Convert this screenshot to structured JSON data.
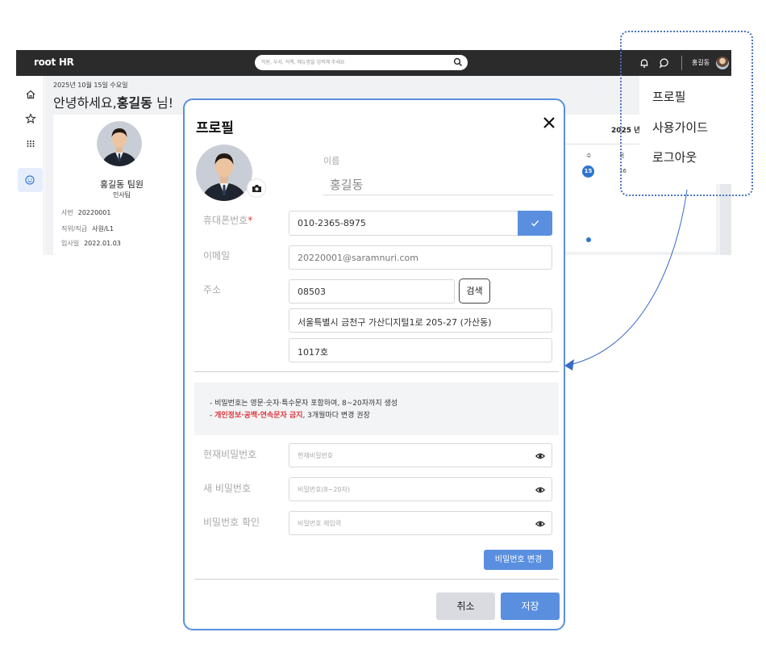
{
  "topbar": {
    "logo": "root HR",
    "search_placeholder": "직원, 부서, 직책, 메뉴명을 입력해 주세요",
    "user_name": "홍길동"
  },
  "dashboard": {
    "date": "2025년 10월 15일 수요일",
    "greeting_prefix": "안녕하세요,",
    "greeting_name": "홍길동",
    "greeting_suffix": " 님!",
    "profile_card": {
      "name": "홍길동  팀원",
      "dept": "인사팀",
      "info": [
        {
          "key": "사번",
          "value": "20220001"
        },
        {
          "key": "직위/직급",
          "value": "사원/L1"
        },
        {
          "key": "입사일",
          "value": "2022.01.03"
        }
      ]
    },
    "calendar": {
      "title": "2025 년",
      "weekday_1": "수",
      "weekday_2": "목",
      "today": "15",
      "next": "16"
    }
  },
  "user_menu": {
    "items": [
      "프로필",
      "사용가이드",
      "로그아웃"
    ]
  },
  "profile_modal": {
    "title": "프로필",
    "name_label": "이름",
    "name_value": "홍길동",
    "phone_label": "휴대폰번호",
    "phone_required": "*",
    "phone_value": "010-2365-8975",
    "email_label": "이메일",
    "email_value": "20220001@saramnuri.com",
    "address_label": "주소",
    "zipcode": "08503",
    "search_button": "검색",
    "address_line1": "서울특별시 금천구 가산디지털1로 205-27 (가산동)",
    "address_line2": "1017호",
    "notice": {
      "line1": "- 비밀번호는 영문·숫자·특수문자 포함하여, 8~20자까지 생성",
      "line2_prefix": "- ",
      "line2_red": "개인정보·공백·연속문자 금지",
      "line2_suffix": ", 3개월마다 변경 권장"
    },
    "current_pw_label": "현재비밀번호",
    "current_pw_placeholder": "현재비밀번호",
    "new_pw_label": "새 비밀번호",
    "new_pw_placeholder": "비밀번호(8~20자)",
    "confirm_pw_label": "비밀번호 확인",
    "confirm_pw_placeholder": "비밀번호 재입력",
    "change_pw_button": "비밀번호 변경",
    "cancel_button": "취소",
    "save_button": "저장"
  },
  "colors": {
    "accent": "#5a8fe0",
    "topbar": "#2b2b2b",
    "required": "#e03a3a"
  }
}
